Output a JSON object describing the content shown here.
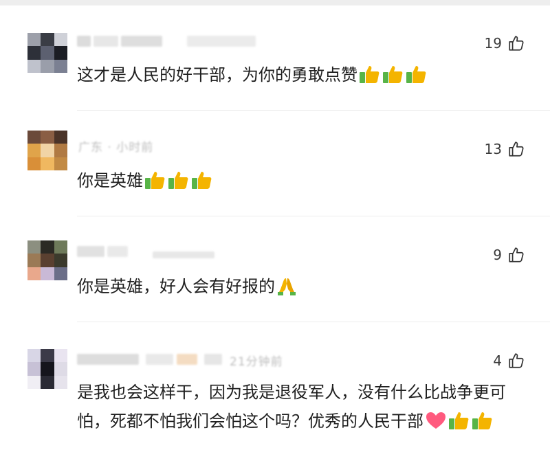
{
  "comments": [
    {
      "likes": "19",
      "text": "这才是人民的好干部，为你的勇敢点赞",
      "meta": "",
      "emoji": [
        "thumbs-up",
        "thumbs-up",
        "thumbs-up"
      ]
    },
    {
      "likes": "13",
      "text": "你是英雄",
      "meta": "广东 · 小时前",
      "emoji": [
        "thumbs-up",
        "thumbs-up",
        "thumbs-up"
      ]
    },
    {
      "likes": "9",
      "text": "你是英雄，好人会有好报的",
      "meta": "",
      "emoji": [
        "folded-hands"
      ]
    },
    {
      "likes": "4",
      "text": "是我也会这样干，因为我是退役军人，没有什么比战争更可怕，死都不怕我们会怕这个吗？优秀的人民干部",
      "meta": "21分钟前",
      "emoji": [
        "red-heart",
        "thumbs-up",
        "thumbs-up"
      ]
    }
  ],
  "icons": {
    "like": "thumb-up-outline-icon"
  },
  "colors": {
    "text": "#1f1f1f",
    "count": "#3a3a3a",
    "divider": "#ececec",
    "emoji_yellow": "#f4b400",
    "emoji_green": "#58b447",
    "heart": "#ff5a7e"
  }
}
